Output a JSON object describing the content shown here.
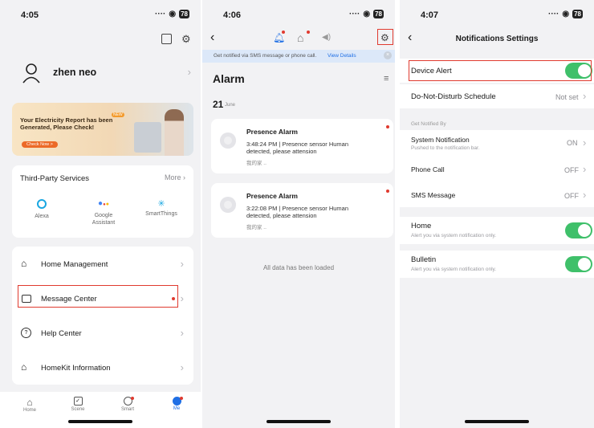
{
  "screen1": {
    "time": "4:05",
    "battery": "78",
    "user_name": "zhen neo",
    "banner": {
      "badge": "NEW",
      "title": "Your Electricity Report has been Generated, Please Check!",
      "cta": "Check Now >"
    },
    "third_party": {
      "title": "Third-Party Services",
      "more": "More",
      "items": [
        "Alexa",
        "Google Assistant",
        "SmartThings"
      ]
    },
    "menu": [
      "Home Management",
      "Message Center",
      "Help Center",
      "HomeKit Information"
    ],
    "tabs": [
      "Home",
      "Scene",
      "Smart",
      "Me"
    ],
    "accent": "#1f6fe5"
  },
  "screen2": {
    "time": "4:06",
    "battery": "78",
    "notice": "Get notified via SMS message or phone call.",
    "notice_link": "View Details",
    "title": "Alarm",
    "date_day": "21",
    "date_month": "June",
    "alarms": [
      {
        "title": "Presence Alarm",
        "body": "3:48:24 PM | Presence sensor Human detected, please attension",
        "home": "我的家 .."
      },
      {
        "title": "Presence Alarm",
        "body": "3:22:08 PM | Presence sensor Human detected, please attension",
        "home": "我的家 .."
      }
    ],
    "footer": "All data has been loaded"
  },
  "screen3": {
    "time": "4:07",
    "battery": "78",
    "title": "Notifications Settings",
    "device_alert": "Device Alert",
    "dnd": "Do-Not-Disturb Schedule",
    "dnd_value": "Not set",
    "section": "Get Notified By",
    "system_notification": "System Notification",
    "system_notification_sub": "Pushed to the notification bar.",
    "system_notification_value": "ON",
    "phone_call": "Phone Call",
    "phone_call_value": "OFF",
    "sms": "SMS Message",
    "sms_value": "OFF",
    "home": "Home",
    "home_sub": "Alert you via system notification only.",
    "bulletin": "Bulletin",
    "bulletin_sub": "Alert you via system notification only.",
    "toggle_color": "#3fc06a"
  }
}
